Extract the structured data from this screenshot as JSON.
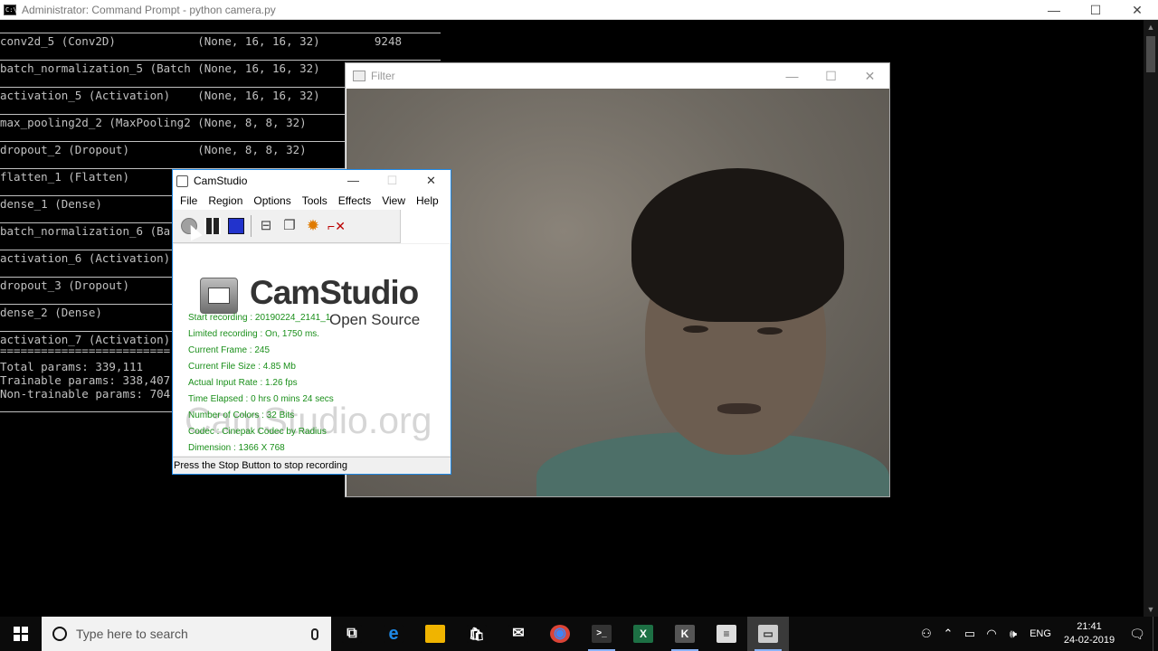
{
  "cmd": {
    "title": "Administrator: Command Prompt - python  camera.py",
    "window_controls": [
      "—",
      "☐",
      "✕"
    ],
    "lines": [
      "conv2d_5 (Conv2D)            (None, 16, 16, 32)        9248",
      "batch_normalization_5 (Batch (None, 16, 16, 32)",
      "activation_5 (Activation)    (None, 16, 16, 32)",
      "max_pooling2d_2 (MaxPooling2 (None, 8, 8, 32)",
      "dropout_2 (Dropout)          (None, 8, 8, 32)",
      "flatten_1 (Flatten)",
      "dense_1 (Dense)",
      "batch_normalization_6 (Ba",
      "activation_6 (Activation)",
      "dropout_3 (Dropout)",
      "dense_2 (Dense)",
      "activation_7 (Activation)",
      "=========================",
      "Total params: 339,111",
      "Trainable params: 338,407",
      "Non-trainable params: 704"
    ]
  },
  "filter": {
    "title": "Filter",
    "window_controls": [
      "—",
      "☐",
      "✕"
    ]
  },
  "camstudio": {
    "title": "CamStudio",
    "window_controls": [
      "—",
      "☐",
      "✕"
    ],
    "menu": [
      "File",
      "Region",
      "Options",
      "Tools",
      "Effects",
      "View",
      "Help"
    ],
    "logo_text": "CamStudio",
    "logo_sub": "Open Source",
    "watermark": "CamStudio.org",
    "stats": [
      "Start recording : 20190224_2141_1",
      "Limited recording : On, 1750 ms.",
      "Current Frame : 245",
      "Current File Size : 4.85 Mb",
      "Actual Input Rate : 1.26 fps",
      "Time Elapsed : 0 hrs 0 mins 24 secs",
      "Number of Colors : 32 Bits",
      "Codec : Cinepak Codec by Radius",
      "Dimension : 1366 X 768"
    ],
    "status": "Press the Stop Button to stop recording"
  },
  "taskbar": {
    "search_placeholder": "Type here to search",
    "apps": [
      {
        "name": "task-view",
        "glyph": "⧉",
        "color": "#0b0b0b"
      },
      {
        "name": "edge",
        "glyph": "e",
        "color": "#1e88e5"
      },
      {
        "name": "file-explorer",
        "glyph": "▬",
        "color": "#f0b400"
      },
      {
        "name": "store",
        "glyph": "🛍",
        "color": "#0b0b0b"
      },
      {
        "name": "mail",
        "glyph": "✉",
        "color": "#0b0b0b"
      },
      {
        "name": "chrome",
        "glyph": "◉",
        "color": "#0f9d58"
      },
      {
        "name": "command-prompt",
        "glyph": ">_",
        "color": "#333333"
      },
      {
        "name": "excel",
        "glyph": "X",
        "color": "#1d7044"
      },
      {
        "name": "camstudio-taskbar",
        "glyph": "K",
        "color": "#555555"
      },
      {
        "name": "notes",
        "glyph": "≡",
        "color": "#dddddd"
      },
      {
        "name": "filter-window",
        "glyph": "▭",
        "color": "#cccccc"
      }
    ],
    "tray": {
      "language": "ENG",
      "time": "21:41",
      "date": "24-02-2019"
    }
  }
}
